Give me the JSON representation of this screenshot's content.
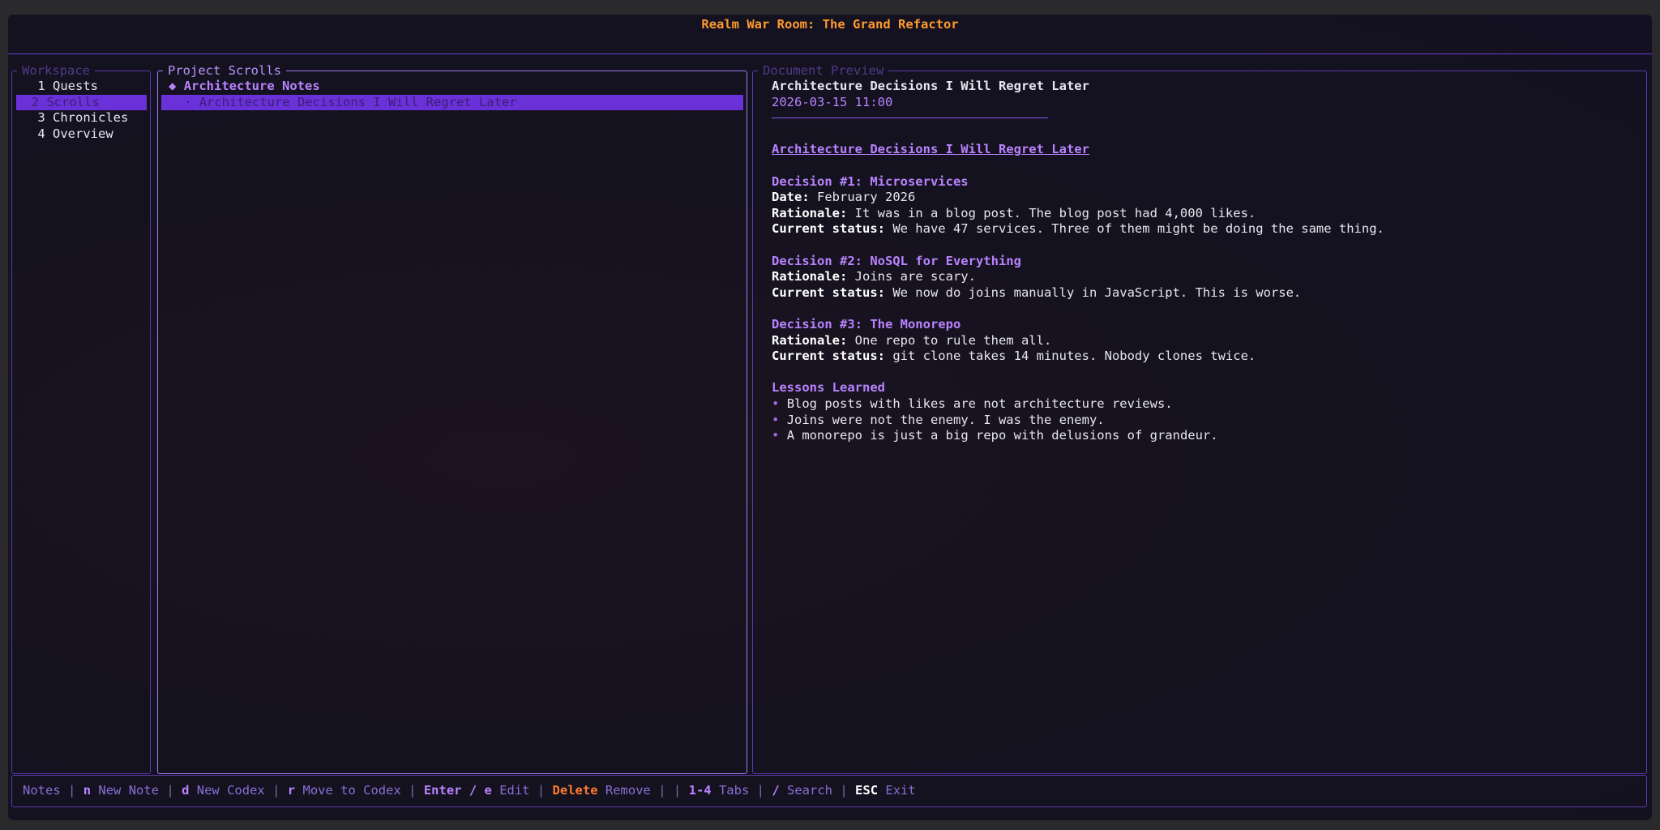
{
  "app": {
    "title": "Realm War Room: The Grand Refactor"
  },
  "workspace": {
    "title": "Workspace",
    "tabs": [
      {
        "label": "1 Quests"
      },
      {
        "label": "2 Scrolls"
      },
      {
        "label": "3 Chronicles"
      },
      {
        "label": "4 Overview"
      }
    ],
    "selected_index": 1
  },
  "scrolls": {
    "title": "Project Scrolls",
    "codex": {
      "bullet": "◆",
      "label": "Architecture Notes"
    },
    "items": [
      {
        "bullet": "·",
        "label": "Architecture Decisions I Will Regret Later"
      }
    ]
  },
  "preview": {
    "title": "Document Preview",
    "doc_title": "Architecture Decisions I Will Regret Later",
    "date": "2026-03-15 11:00",
    "heading": "Architecture Decisions I Will Regret Later",
    "sections": [
      {
        "heading": "Decision #1: Microservices",
        "fields": [
          {
            "label": "Date:",
            "value": " February 2026"
          },
          {
            "label": "Rationale:",
            "value": " It was in a blog post. The blog post had 4,000 likes."
          },
          {
            "label": "Current status:",
            "value": " We have 47 services. Three of them might be doing the same thing."
          }
        ]
      },
      {
        "heading": "Decision #2: NoSQL for Everything",
        "fields": [
          {
            "label": "Rationale:",
            "value": " Joins are scary."
          },
          {
            "label": "Current status:",
            "value": " We now do joins manually in JavaScript. This is worse."
          }
        ]
      },
      {
        "heading": "Decision #3: The Monorepo",
        "fields": [
          {
            "label": "Rationale:",
            "value": " One repo to rule them all."
          },
          {
            "label": "Current status:",
            "value": " git clone takes 14 minutes. Nobody clones twice."
          }
        ]
      }
    ],
    "lessons": {
      "heading": "Lessons Learned",
      "bullet": "•",
      "items": [
        "Blog posts with likes are not architecture reviews.",
        "Joins were not the enemy. I was the enemy.",
        "A monorepo is just a big repo with delusions of grandeur."
      ]
    }
  },
  "footer": {
    "mode": "Notes",
    "sep": "|",
    "new_note_key": "n",
    "new_note_label": "New Note",
    "new_codex_key": "d",
    "new_codex_label": "New Codex",
    "move_key": "r",
    "move_label": "Move to Codex",
    "edit_key": "Enter / e",
    "edit_label": "Edit",
    "delete_key": "Delete",
    "delete_label": "Remove",
    "tabs_key": "1-4",
    "tabs_label": "Tabs",
    "search_key": "/",
    "search_label": "Search",
    "exit_key": "ESC",
    "exit_label": "Exit"
  },
  "colors": {
    "accent": "#6b31d8",
    "title": "#ff9a2e",
    "heading": "#b983ff",
    "delete": "#ff7a2e"
  }
}
